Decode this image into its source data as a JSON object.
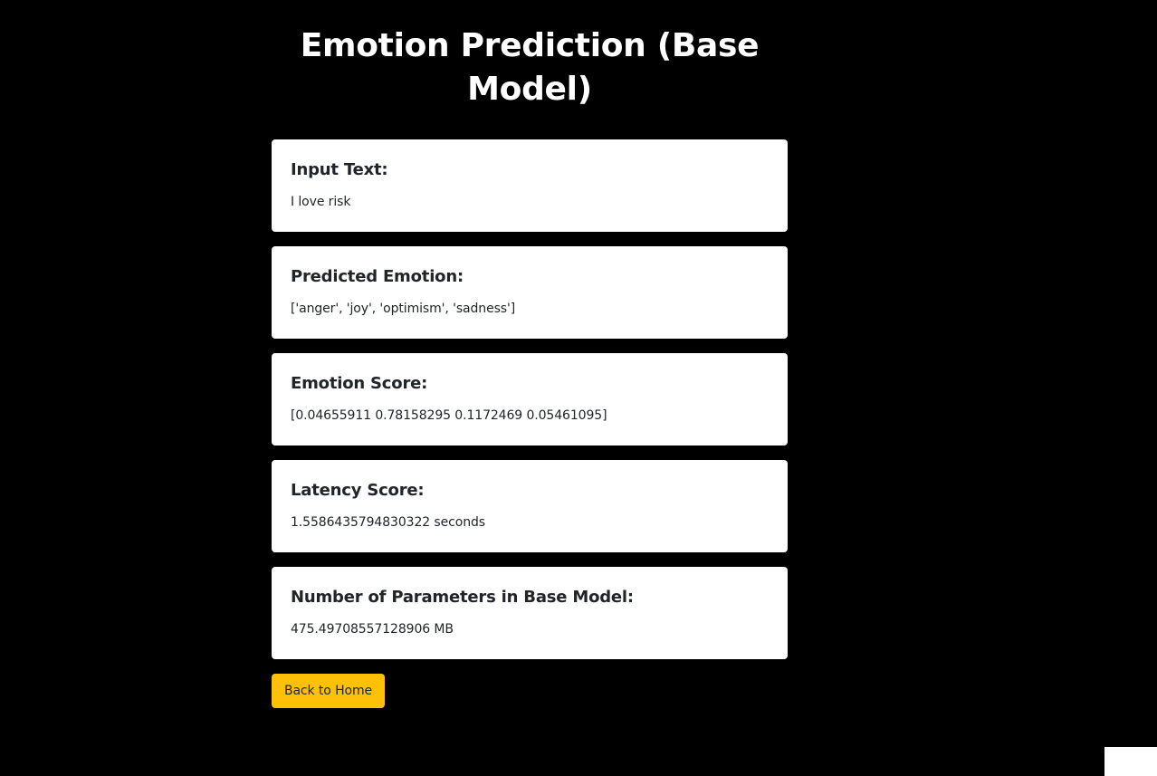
{
  "page": {
    "title": "Emotion Prediction (Base Model)"
  },
  "cards": [
    {
      "heading": "Input Text:",
      "value": "I love risk"
    },
    {
      "heading": "Predicted Emotion:",
      "value": "['anger', 'joy', 'optimism', 'sadness']"
    },
    {
      "heading": "Emotion Score:",
      "value": "[0.04655911 0.78158295 0.1172469  0.05461095]"
    },
    {
      "heading": "Latency Score:",
      "value": "1.5586435794830322 seconds"
    },
    {
      "heading": "Number of Parameters in Base Model:",
      "value": "475.49708557128906 MB"
    }
  ],
  "actions": {
    "back_label": "Back to Home"
  },
  "colors": {
    "background": "#000000",
    "card": "#ffffff",
    "text": "#212529",
    "button": "#ffc107"
  }
}
